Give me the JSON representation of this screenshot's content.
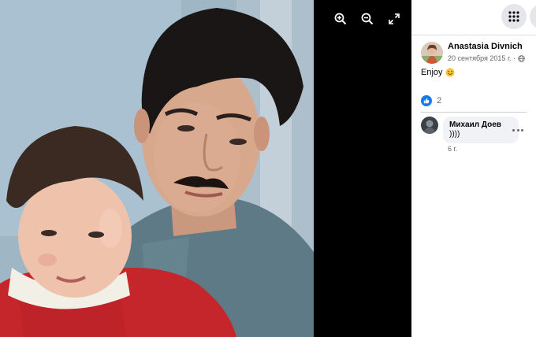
{
  "viewer": {
    "tools": [
      {
        "icon": "zoom-in-icon"
      },
      {
        "icon": "zoom-out-icon"
      },
      {
        "icon": "fullscreen-icon"
      }
    ],
    "photo_desc_icon": "family-photo"
  },
  "panel": {
    "menu_icon": "grid-menu-icon",
    "post": {
      "author": "Anastasia Divnich",
      "date": "20 сентября 2015 г. ·",
      "privacy_icon": "globe-icon",
      "text": "Enjoy",
      "emoji_icon": "smile-emoji-icon"
    },
    "reactions": {
      "icon": "like-icon",
      "count": "2"
    },
    "comment": {
      "author": "Михаил Доев",
      "text": "))))",
      "time": "6 г."
    }
  },
  "colors": {
    "accent": "#1877f2",
    "panel_bg": "#ffffff",
    "viewer_bg": "#000000",
    "bubble_bg": "#f0f2f5",
    "muted_text": "#65676b"
  }
}
